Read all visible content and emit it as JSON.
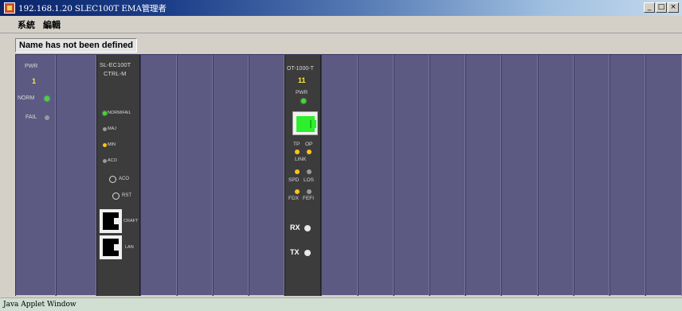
{
  "window": {
    "title": "192.168.1.20 SLEC100T EMA管理者",
    "buttons": {
      "minimize": "_",
      "maximize": "□",
      "close": "×"
    }
  },
  "menu": {
    "items": [
      "系統",
      "編輯"
    ]
  },
  "namebar": {
    "text": "Name has not been defined"
  },
  "psu_card": {
    "pwr_label": "PWR",
    "pwr_value": "1",
    "norm_label": "NORM",
    "fail_label": "FAIL"
  },
  "ctrl_card": {
    "model_line1": "SL-EC100T",
    "model_line2": "CTRL-M",
    "leds": [
      "NORM/FAIL",
      "MAJ",
      "MIN",
      "ACO"
    ],
    "aco_button": "ACO",
    "rst_button": "RST",
    "craft_label": "CRAFT",
    "lan_label": "LAN"
  },
  "ot_card": {
    "model": "OT-1000-T",
    "slot_number": "11",
    "pwr_label": "PWR",
    "tp_label": "TP",
    "op_label": "OP",
    "link_label": "LINK",
    "spd_label": "SPD",
    "los_label": "LOS",
    "fdx_label": "FDX",
    "fefi_label": "FEFI",
    "rx_label": "RX",
    "tx_label": "TX"
  },
  "status": {
    "text": "Java Applet Window"
  },
  "colors": {
    "chassis": "#5c5a82",
    "card": "#3c3c3c",
    "led_green": "#37e02b",
    "led_amber": "#ffc21a",
    "slot_number": "#ffea3a"
  }
}
